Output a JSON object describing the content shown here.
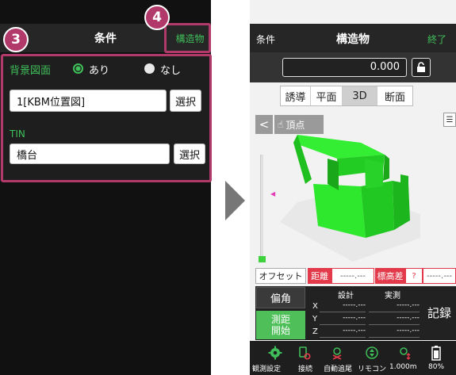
{
  "left": {
    "title": "条件",
    "struct_button": "構造物",
    "background_label": "背景図面",
    "radio_yes": "あり",
    "radio_no": "なし",
    "background_value": "1[KBM位置図]",
    "select_label": "選択",
    "tin_label": "TIN",
    "tin_value": "橋台",
    "badge3": "3",
    "badge4": "4"
  },
  "right": {
    "header_left": "条件",
    "header_title": "構造物",
    "header_right": "終了",
    "value": "0.000",
    "tabs": [
      "誘導",
      "平面",
      "3D",
      "断面"
    ],
    "active_tab": "3D",
    "vertex_label": "頂点",
    "offset_label": "オフセット",
    "distance_label": "距離",
    "distance_value": "-----.---",
    "height_diff_label": "標高差",
    "height_diff_value": "?",
    "height_diff_value2": "-----.---",
    "angle_button": "偏角",
    "measure_button_line1": "測距",
    "measure_button_line2": "開始",
    "col_design": "設計",
    "col_actual": "実測",
    "rows": [
      {
        "axis": "X",
        "design": "-----.---",
        "actual": "-----.---"
      },
      {
        "axis": "Y",
        "design": "-----.---",
        "actual": "-----.---"
      },
      {
        "axis": "Z",
        "design": "-----.---",
        "actual": "-----.---"
      }
    ],
    "record_button": "記録",
    "bottom": [
      {
        "icon": "gear-icon",
        "label": "観測設定"
      },
      {
        "icon": "connection-icon",
        "label": "接続"
      },
      {
        "icon": "auto-track-icon",
        "label": "自動追尾"
      },
      {
        "icon": "remote-icon",
        "label": "リモコン"
      },
      {
        "icon": "distance-icon",
        "label": "1.000m"
      },
      {
        "icon": "battery-icon",
        "label": "80%"
      }
    ],
    "colors": {
      "accent": "#3fbf5a",
      "model": "#22dd22",
      "highlight": "#b23a6a",
      "alert": "#e23a4a"
    }
  }
}
